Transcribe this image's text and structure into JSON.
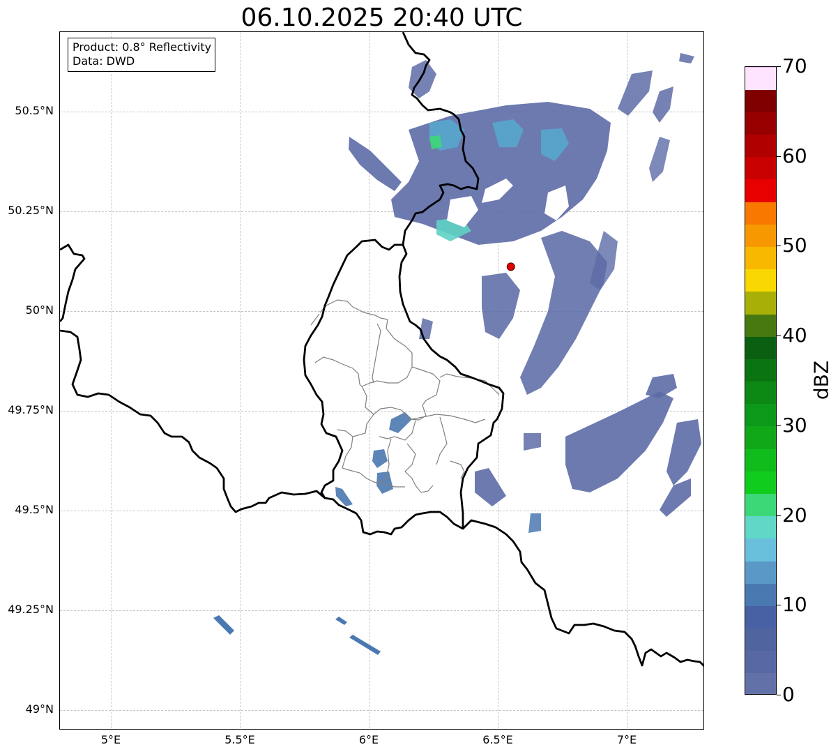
{
  "title": "06.10.2025 20:40 UTC",
  "info": {
    "product": "Product: 0.8° Reflectivity",
    "source": "Data: DWD"
  },
  "axes": {
    "lat_ticks": [
      "50.5°N",
      "50.25°N",
      "50°N",
      "49.75°N",
      "49.5°N",
      "49.25°N",
      "49°N"
    ],
    "lon_ticks": [
      "5°E",
      "5.5°E",
      "6°E",
      "6.5°E",
      "7°E"
    ],
    "lon_range": [
      4.8,
      7.3
    ],
    "lat_range": [
      48.95,
      50.7
    ]
  },
  "colorbar": {
    "label": "dBZ",
    "ticks": [
      "0",
      "10",
      "20",
      "30",
      "40",
      "50",
      "60",
      "70"
    ],
    "range": [
      0,
      70
    ],
    "step": 2.5,
    "colors": [
      "#6272a8",
      "#5868a4",
      "#5064a0",
      "#4860a4",
      "#4a78b0",
      "#5a98c8",
      "#68c0dc",
      "#60d8c8",
      "#3cd878",
      "#10cc1c",
      "#10bc1c",
      "#10a818",
      "#0c9818",
      "#0c8814",
      "#0a7410",
      "#0a6010",
      "#487810",
      "#a8b008",
      "#f8d800",
      "#f8b800",
      "#f89800",
      "#f87800",
      "#e80000",
      "#c80000",
      "#b00000",
      "#980000",
      "#800000",
      "#ffe4ff",
      "#ffb4ff",
      "#ff70ff",
      "#e838e8"
    ]
  },
  "radar_site": {
    "lon": 6.548,
    "lat": 50.112
  },
  "colors": {
    "site_marker": "#e00000",
    "border": "#000000",
    "district": "#808080",
    "grid": "#b0b0b0"
  }
}
